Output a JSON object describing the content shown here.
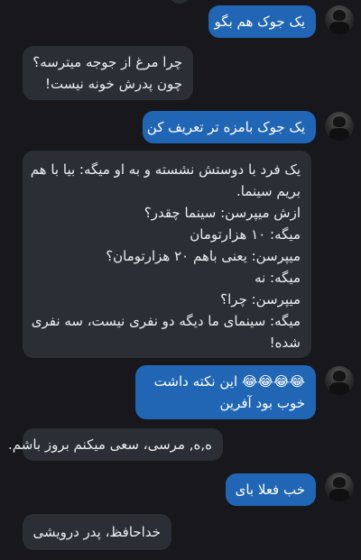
{
  "messages": [
    {
      "from": "user",
      "lines": [
        "یک جوک هم بگو"
      ]
    },
    {
      "from": "bot",
      "lines": [
        "چرا مرغ از جوجه میترسه؟",
        "چون پدرش خونه نیست!"
      ]
    },
    {
      "from": "user",
      "lines": [
        "یک جوک بامزه تر تعریف کن"
      ]
    },
    {
      "from": "bot",
      "lines": [
        "یک فرد با دوستش نشسته و به او میگه: بیا با هم",
        "بریم سینما.",
        "ازش میپرسن: سینما چقدر؟",
        "میگه: ۱۰ هزارتومان",
        "میپرسن: یعنی باهم ۲۰ هزارتومان؟",
        "میگه: نه",
        "میپرسن: چرا؟",
        "میگه: سینمای ما دیگه دو نفری نیست، سه نفری",
        "شده!"
      ]
    },
    {
      "from": "user",
      "lines": [
        "😂😂😂😂 این نکته داشت",
        "خوب بود آفرین"
      ]
    },
    {
      "from": "bot",
      "lines": [
        "ﻩ,ﻩ, مرسی، سعی میکنم بروز باشم."
      ]
    },
    {
      "from": "user",
      "lines": [
        "خب فعلا بای"
      ]
    },
    {
      "from": "bot",
      "lines": [
        "خداحافظ، پدر درویشی"
      ]
    }
  ],
  "colors": {
    "background": "#17171c",
    "user_bubble": "#2166b5",
    "bot_bubble": "#2b2e34"
  },
  "icons": {
    "user_avatar": "user-avatar-icon"
  }
}
